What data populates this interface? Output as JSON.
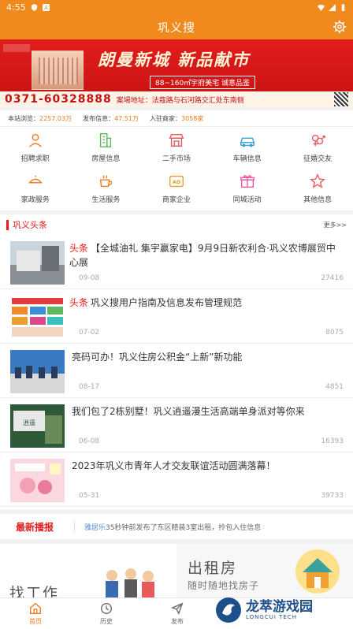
{
  "status_bar": {
    "time": "4:55",
    "icons": [
      "shield-icon",
      "a-icon",
      "wifi-icon",
      "signal-icon",
      "battery-icon"
    ]
  },
  "header": {
    "title": "巩义搜"
  },
  "banner": {
    "headline": "朗曼新城  新品献市",
    "subline": "88~160㎡宇府美宅 诚意品鉴",
    "phone": "0371-60328888",
    "address": "案場地址：法蔻路与石河路交汇处东南侧"
  },
  "stats": {
    "visits_label": "本站浏览：",
    "visits_value": "2257.03万",
    "posts_label": "发布信息：",
    "posts_value": "47.51万",
    "members_label": "入驻商家：",
    "members_value": "3058家"
  },
  "categories": [
    {
      "label": "招聘求职",
      "icon": "people-icon"
    },
    {
      "label": "房屋信息",
      "icon": "building-icon"
    },
    {
      "label": "二手市场",
      "icon": "store-icon"
    },
    {
      "label": "车辆信息",
      "icon": "car-icon"
    },
    {
      "label": "征婚交友",
      "icon": "gender-icon"
    },
    {
      "label": "家政服务",
      "icon": "service-icon"
    },
    {
      "label": "生活服务",
      "icon": "tea-icon"
    },
    {
      "label": "商家企业",
      "icon": "ad-icon"
    },
    {
      "label": "同城活动",
      "icon": "gift-icon"
    },
    {
      "label": "其他信息",
      "icon": "star-icon"
    }
  ],
  "news_section": {
    "title": "巩义头条",
    "more": "更多>>"
  },
  "news": [
    {
      "tag": "头条",
      "title": "【全城油礼 集宇赢家电】9月9日新农利合·巩义农博展贸中心展",
      "date": "09-08",
      "views": "27416"
    },
    {
      "tag": "头条",
      "title": "巩义搜用户指南及信息发布管理规范",
      "date": "07-02",
      "views": "8075"
    },
    {
      "tag": "",
      "title": "亮码可办！巩义住房公积金“上新”新功能",
      "date": "08-17",
      "views": "4851"
    },
    {
      "tag": "",
      "title": "我们包了2栋别墅！巩义逍遥漫生活高端单身派对等你来",
      "date": "06-08",
      "views": "16393"
    },
    {
      "tag": "",
      "title": "2023年巩义市青年人才交友联谊活动圆满落幕！",
      "date": "05-31",
      "views": "39733"
    }
  ],
  "broadcast": {
    "title": "最新播报",
    "user": "雅居乐",
    "text": "35秒钟前发布了东区精装3室出租，拎包入住信息"
  },
  "promo": {
    "left_title": "找工作",
    "right_title": "出租房",
    "right_sub": "随时随地找房子"
  },
  "tabs": [
    {
      "label": "首页",
      "icon": "home-icon"
    },
    {
      "label": "历史",
      "icon": "clock-icon"
    },
    {
      "label": "发布",
      "icon": "send-icon"
    }
  ],
  "watermark": {
    "title": "龙萃游戏园",
    "sub": "LONGCUI TECH"
  },
  "colors": {
    "primary": "#f08a1c",
    "accent_red": "#e21d1d"
  }
}
